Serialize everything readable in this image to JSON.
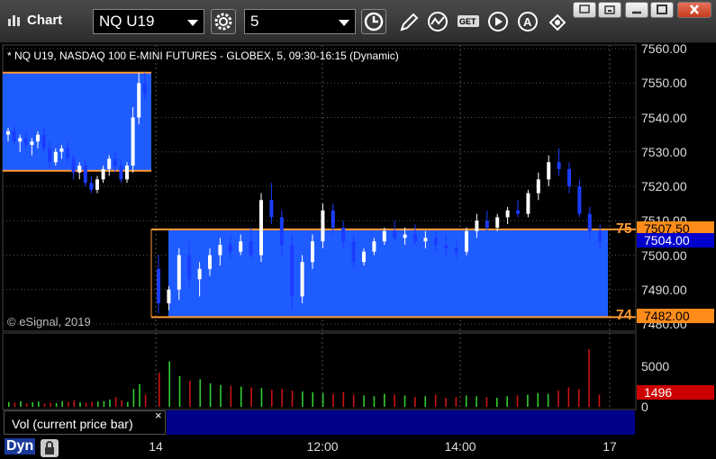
{
  "window": {
    "title": "Chart",
    "symbol": "NQ U19",
    "interval": "5"
  },
  "chart_header": "* NQ U19, NASDAQ 100 E-MINI FUTURES - GLOBEX, 5, 09:30-16:15 (Dynamic)",
  "copyright": "© eSignal, 2019",
  "price_axis": [
    "7560.00",
    "7550.00",
    "7540.00",
    "7530.00",
    "7520.00",
    "7510.00",
    "7500.00",
    "7490.00",
    "7480.00"
  ],
  "volume_axis": [
    "5000",
    "0"
  ],
  "time_axis": [
    "14",
    "12:00",
    "14:00",
    "17"
  ],
  "price_tags": {
    "upper_level": "7507.50",
    "last_price": "7504.00",
    "lower_level": "7482.00",
    "last_volume": "1496"
  },
  "level_labels": {
    "upper": "75",
    "lower": "74"
  },
  "volume_study_label": "Vol (current price bar)",
  "volume_close": "×",
  "bottom": {
    "mode_label": "Dyn"
  },
  "colors": {
    "up_candle": "#ffffff",
    "down_candle": "#1a3cff",
    "zone_fill": "#1f5cff",
    "level_line": "#ff9933",
    "vol_up": "#33cc33",
    "vol_down": "#cc1111",
    "last_price_tag": "#0000cc",
    "level_tag": "#ff8c1a"
  },
  "icons": [
    "chart-icon",
    "settings-gear-icon",
    "clock-icon",
    "pencil-icon",
    "study-icon",
    "get-icon",
    "play-icon",
    "alert-icon",
    "link-icon",
    "minimize-icon",
    "restore-icon",
    "maximize-icon",
    "close-icon",
    "lock-icon"
  ],
  "chart_data": {
    "type": "candlestick",
    "title": "* NQ U19, NASDAQ 100 E-MINI FUTURES - GLOBEX, 5, 09:30-16:15 (Dynamic)",
    "ylim": [
      7478,
      7563
    ],
    "levels": {
      "prev_zone": [
        7524.5,
        7553
      ],
      "today_zone": [
        7482,
        7507.5
      ]
    },
    "candles_prev": [
      [
        7535,
        7537,
        7533,
        7536
      ],
      [
        7536,
        7538,
        7532,
        7533
      ],
      [
        7533,
        7535,
        7530,
        7534
      ],
      [
        7534,
        7536,
        7531,
        7532
      ],
      [
        7532,
        7534,
        7529,
        7533
      ],
      [
        7533,
        7536,
        7531,
        7535
      ],
      [
        7535,
        7537,
        7530,
        7531
      ],
      [
        7531,
        7533,
        7525,
        7527
      ],
      [
        7527,
        7531,
        7526,
        7530
      ],
      [
        7530,
        7532,
        7528,
        7531
      ],
      [
        7531,
        7533,
        7527,
        7528
      ],
      [
        7528,
        7529,
        7522,
        7524
      ],
      [
        7524,
        7527,
        7522,
        7526
      ],
      [
        7526,
        7528,
        7520,
        7521
      ],
      [
        7521,
        7523,
        7518,
        7519
      ],
      [
        7519,
        7523,
        7518,
        7522
      ],
      [
        7522,
        7526,
        7521,
        7525
      ],
      [
        7525,
        7529,
        7523,
        7528
      ],
      [
        7528,
        7530,
        7524,
        7526
      ],
      [
        7526,
        7528,
        7521,
        7522
      ],
      [
        7522,
        7527,
        7521,
        7526
      ],
      [
        7526,
        7543,
        7524,
        7540
      ],
      [
        7540,
        7553,
        7538,
        7550
      ],
      [
        7550,
        7553,
        7545,
        7547
      ]
    ],
    "candles_today": [
      [
        7496,
        7500,
        7483,
        7486
      ],
      [
        7486,
        7491,
        7484,
        7490
      ],
      [
        7490,
        7502,
        7487,
        7500
      ],
      [
        7500,
        7504,
        7490,
        7493
      ],
      [
        7493,
        7498,
        7488,
        7496
      ],
      [
        7496,
        7502,
        7494,
        7500
      ],
      [
        7500,
        7505,
        7497,
        7503
      ],
      [
        7503,
        7506,
        7499,
        7501
      ],
      [
        7501,
        7506,
        7500,
        7504
      ],
      [
        7504,
        7508,
        7499,
        7500
      ],
      [
        7500,
        7518,
        7498,
        7516
      ],
      [
        7516,
        7521,
        7509,
        7511
      ],
      [
        7511,
        7513,
        7500,
        7503
      ],
      [
        7503,
        7506,
        7484,
        7488
      ],
      [
        7488,
        7500,
        7486,
        7498
      ],
      [
        7498,
        7506,
        7496,
        7504
      ],
      [
        7504,
        7515,
        7502,
        7513
      ],
      [
        7513,
        7515,
        7506,
        7508
      ],
      [
        7508,
        7510,
        7502,
        7504
      ],
      [
        7504,
        7506,
        7496,
        7498
      ],
      [
        7498,
        7502,
        7497,
        7501
      ],
      [
        7501,
        7505,
        7500,
        7504
      ],
      [
        7504,
        7508,
        7503,
        7507
      ],
      [
        7507,
        7510,
        7504,
        7505
      ],
      [
        7505,
        7508,
        7503,
        7506
      ],
      [
        7506,
        7509,
        7503,
        7504
      ],
      [
        7504,
        7507,
        7502,
        7505
      ],
      [
        7505,
        7507,
        7501,
        7503
      ],
      [
        7503,
        7506,
        7500,
        7502
      ],
      [
        7502,
        7504,
        7499,
        7501
      ],
      [
        7501,
        7508,
        7500,
        7507
      ],
      [
        7507,
        7512,
        7505,
        7510
      ],
      [
        7510,
        7513,
        7507,
        7508
      ],
      [
        7508,
        7512,
        7507,
        7511
      ],
      [
        7511,
        7514,
        7509,
        7513
      ],
      [
        7513,
        7516,
        7511,
        7512
      ],
      [
        7512,
        7519,
        7511,
        7518
      ],
      [
        7518,
        7524,
        7516,
        7522
      ],
      [
        7522,
        7529,
        7520,
        7527
      ],
      [
        7527,
        7531,
        7523,
        7525
      ],
      [
        7525,
        7527,
        7518,
        7520
      ],
      [
        7520,
        7522,
        7511,
        7512
      ],
      [
        7512,
        7514,
        7505,
        7507
      ],
      [
        7507,
        7509,
        7502,
        7504
      ]
    ],
    "volume": [
      600,
      500,
      700,
      450,
      550,
      650,
      400,
      500,
      450,
      700,
      600,
      800,
      550,
      500,
      600,
      650,
      700,
      900,
      1200,
      800,
      600,
      2200,
      2800,
      1500,
      4200,
      5600,
      3800,
      3200,
      3400,
      2900,
      2700,
      2600,
      2500,
      2400,
      2300,
      2100,
      2200,
      2000,
      1900,
      1800,
      1700,
      1600,
      1800,
      1500,
      1400,
      1300,
      1600,
      1500,
      1400,
      1200,
      1300,
      1500,
      1100,
      1200,
      1400,
      1300,
      1200,
      1100,
      1300,
      1400,
      1500,
      1700,
      1600,
      2000,
      2400,
      2200,
      7100,
      1496
    ]
  }
}
